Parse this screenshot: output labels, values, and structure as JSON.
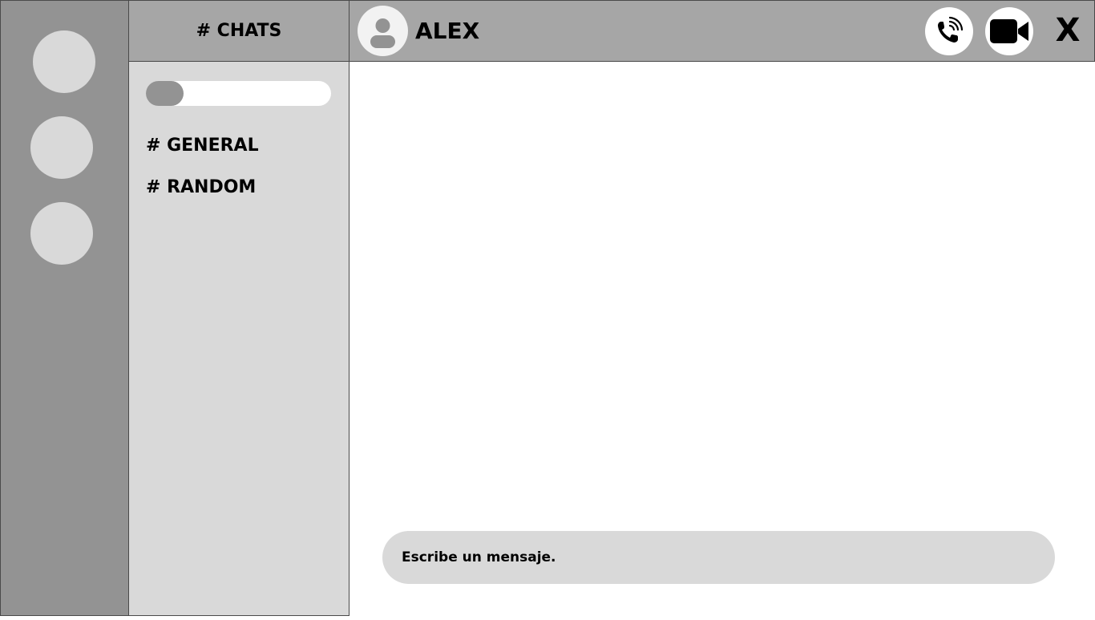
{
  "servers": [
    {
      "icon": "server-avatar"
    },
    {
      "icon": "server-avatar"
    },
    {
      "icon": "server-avatar"
    }
  ],
  "sidebar": {
    "title": "# CHATS",
    "search_icon": "search-toggle",
    "channels": [
      {
        "label": "# GENERAL"
      },
      {
        "label": "# RANDOM"
      }
    ]
  },
  "chat": {
    "contact_name": "ALEX",
    "avatar_icon": "user-icon",
    "actions": {
      "voice_call_icon": "phone-icon",
      "video_call_icon": "video-camera-icon",
      "close_label": "X"
    },
    "composer_placeholder": "Escribe un mensaje."
  },
  "colors": {
    "rail": "#939393",
    "channel_panel": "#d9d9d9",
    "header": "#a6a6a6",
    "surface": "#ffffff",
    "border": "#4a4a4a",
    "text": "#000000"
  }
}
